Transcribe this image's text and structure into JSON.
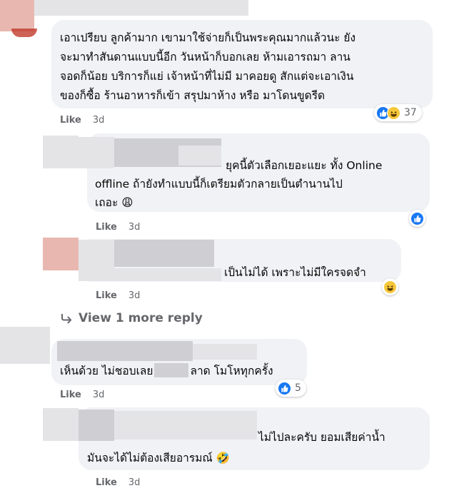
{
  "comments": [
    {
      "text": [
        "เอาเปรียบ ลูกค้ามาก เขามาใช้จ่ายก็เป็นพระคุณมากแล้วนะ ยัง",
        "จะมาทำสันดานแบบนี้อีก วันหน้าก็บอกเลย ห้ามเอารถมา ลาน",
        "จอดก็น้อย บริการก็แย่ เจ้าหน้าที่ไม่มี มาคอยดู สักแต่จะเอาเงิน",
        "ของก็ซื้อ ร้านอาหารก็เข้า สรุปมาห้าง หรือ มาโดนขูดรีด"
      ],
      "like_label": "Like",
      "time": "3d",
      "reaction_count": "37",
      "reactions": [
        "like-icon",
        "haha-icon"
      ]
    },
    {
      "text": [
        "ยุคนี้ตัวเลือกเยอะแยะ ทั้ง Online",
        "offline ถ้ายังทำแบบนี้ก็เตรียมตัวกลายเป็นตำนานไป",
        "เถอะ"
      ],
      "like_label": "Like",
      "time": "3d",
      "reactions": [
        "like-icon"
      ]
    },
    {
      "text": [
        "เป็นไม่ได้ เพราะไม่มีใครจดจำ"
      ],
      "like_label": "Like",
      "time": "3d",
      "reactions": [
        "haha-icon"
      ]
    },
    {
      "text_before": "เห็นด้วย ไม่ชอบเลย",
      "text_after": "ลาด โมโหทุกครั้ง",
      "like_label": "Like",
      "time": "3d",
      "reaction_count": "5",
      "reactions": [
        "like-icon"
      ]
    },
    {
      "text": [
        "ไม่ไปละครับ ยอมเสียค่าน้ำ",
        "มันจะได้ไม่ต้องเสียอารมณ์"
      ],
      "like_label": "Like",
      "time": "3d"
    }
  ],
  "view_more_label": "View 1 more reply",
  "colors": {
    "bubble": "#f0f2f5",
    "meta": "#65676b",
    "like_blue": "#1877f2",
    "haha_yellow": "#f7c73b"
  }
}
